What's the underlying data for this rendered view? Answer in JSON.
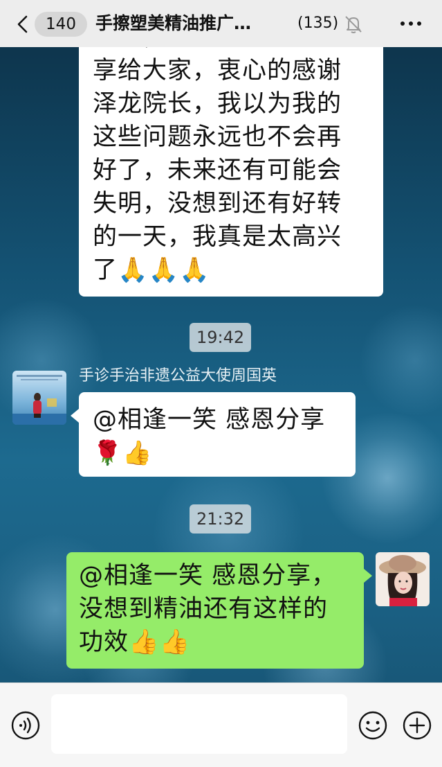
{
  "header": {
    "back_badge": "140",
    "title": "手擦塑美精油推广…",
    "member_count": "(135)",
    "icons": {
      "back": "chevron-left-icon",
      "mute": "bell-muted-icon",
      "more": "more-dots-icon"
    }
  },
  "messages": [
    {
      "type": "incoming",
      "lines": [
        "以言，到时候我再来分",
        "享给大家，衷心的感谢",
        "泽龙院长，我以为我的",
        "这些问题永远也不会再",
        "好了，未来还有可能会",
        "失明，没想到还有好转",
        "的一天，我真是太高兴",
        "了🙏🙏🙏"
      ]
    },
    {
      "type": "time",
      "text": "19:42"
    },
    {
      "type": "incoming",
      "sender": "手诊手治非遗公益大使周国英",
      "lines": [
        "@相逢一笑 感恩分享",
        "🌹👍"
      ]
    },
    {
      "type": "time",
      "text": "21:32"
    },
    {
      "type": "outgoing",
      "lines": [
        "@相逢一笑 感恩分享，",
        "没想到精油还有这样的",
        "功效👍👍"
      ]
    }
  ],
  "input": {
    "value": "",
    "placeholder": ""
  },
  "bottom_icons": {
    "voice": "voice-icon",
    "emoji": "emoji-icon",
    "plus": "plus-icon"
  },
  "colors": {
    "header_bg": "#ededed",
    "bubble_white": "#ffffff",
    "bubble_green": "#95ec69"
  }
}
